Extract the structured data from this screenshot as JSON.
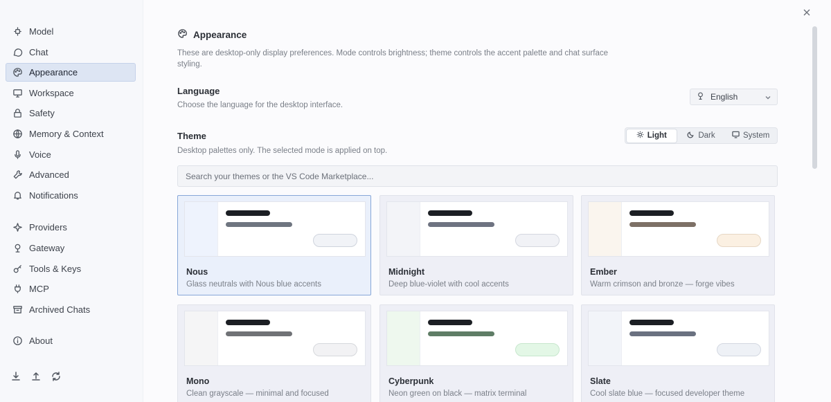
{
  "sidebar": {
    "items": [
      {
        "label": "Model",
        "icon": "model-icon"
      },
      {
        "label": "Chat",
        "icon": "chat-icon"
      },
      {
        "label": "Appearance",
        "icon": "palette-icon"
      },
      {
        "label": "Workspace",
        "icon": "monitor-icon"
      },
      {
        "label": "Safety",
        "icon": "lock-icon"
      },
      {
        "label": "Memory & Context",
        "icon": "globe-icon"
      },
      {
        "label": "Voice",
        "icon": "mic-icon"
      },
      {
        "label": "Advanced",
        "icon": "wrench-icon"
      },
      {
        "label": "Notifications",
        "icon": "bell-icon"
      },
      {
        "label": "Providers",
        "icon": "sparkle-icon"
      },
      {
        "label": "Gateway",
        "icon": "gateway-icon"
      },
      {
        "label": "Tools & Keys",
        "icon": "key-icon"
      },
      {
        "label": "MCP",
        "icon": "plug-icon"
      },
      {
        "label": "Archived Chats",
        "icon": "archive-icon"
      },
      {
        "label": "About",
        "icon": "info-icon"
      }
    ],
    "active": "Appearance",
    "bottom_icons": [
      "download-icon",
      "upload-icon",
      "refresh-icon"
    ]
  },
  "main": {
    "section_title": "Appearance",
    "section_desc": "These are desktop-only display preferences. Mode controls brightness; theme controls the accent palette and chat surface styling.",
    "language": {
      "title": "Language",
      "desc": "Choose the language for the desktop interface.",
      "value": "English"
    },
    "theme": {
      "title": "Theme",
      "desc": "Desktop palettes only. The selected mode is applied on top.",
      "modes": [
        "Light",
        "Dark",
        "System"
      ],
      "active_mode": "Light",
      "search_placeholder": "Search your themes or the VS Code Marketplace..."
    },
    "themes": [
      {
        "name": "Nous",
        "desc": "Glass neutrals with Nous blue accents",
        "selected": true,
        "side": "#eef3fd",
        "bar2": "#6f7580",
        "pill": "#f1f3f7",
        "pill_border": "#cfd4dd"
      },
      {
        "name": "Midnight",
        "desc": "Deep blue-violet with cool accents",
        "selected": false,
        "side": "#f3f4f8",
        "bar2": "#6e7381",
        "pill": "#f1f2f6",
        "pill_border": "#d4d7df"
      },
      {
        "name": "Ember",
        "desc": "Warm crimson and bronze — forge vibes",
        "selected": false,
        "side": "#faf5ee",
        "bar2": "#7d7066",
        "pill": "#fbf0e2",
        "pill_border": "#e6d7c4"
      },
      {
        "name": "Mono",
        "desc": "Clean grayscale — minimal and focused",
        "selected": false,
        "side": "#f5f5f6",
        "bar2": "#707276",
        "pill": "#f2f2f4",
        "pill_border": "#d6d8dc"
      },
      {
        "name": "Cyberpunk",
        "desc": "Neon green on black — matrix terminal",
        "selected": false,
        "side": "#eef8ee",
        "bar2": "#5f7d66",
        "pill": "#e3f7e6",
        "pill_border": "#c7e6cd"
      },
      {
        "name": "Slate",
        "desc": "Cool slate blue — focused developer theme",
        "selected": false,
        "side": "#f2f4f9",
        "bar2": "#6a7180",
        "pill": "#eef1f6",
        "pill_border": "#d3d8e1"
      }
    ]
  }
}
